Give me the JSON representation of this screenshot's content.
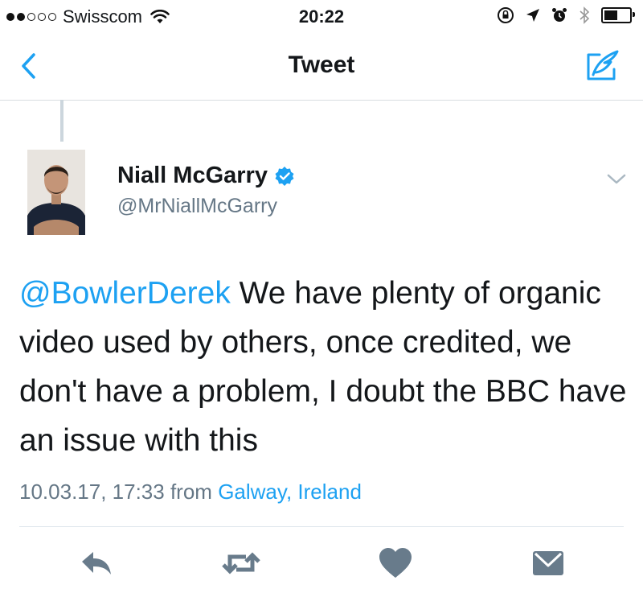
{
  "status_bar": {
    "carrier": "Swisscom",
    "time": "20:22",
    "signal_bars_filled": 2,
    "signal_bars_total": 5,
    "icons": [
      "wifi-icon",
      "orientation-lock-icon",
      "location-arrow-icon",
      "alarm-icon",
      "bluetooth-icon",
      "battery-icon"
    ]
  },
  "nav": {
    "title": "Tweet",
    "back_icon": "chevron-left-icon",
    "compose_icon": "compose-icon"
  },
  "tweet": {
    "display_name": "Niall McGarry",
    "verified": true,
    "handle": "@MrNiallMcGarry",
    "mention": "@BowlerDerek",
    "body": " We have plenty of organic video used by others, once credited, we don't have a problem, I doubt the BBC have an issue with this",
    "timestamp": "10.03.17, 17:33 from",
    "location": "Galway, Ireland"
  },
  "actions": [
    "reply-icon",
    "retweet-icon",
    "like-icon",
    "direct-message-icon"
  ],
  "colors": {
    "accent": "#1da1f2",
    "secondary_text": "#657786",
    "action_icon": "#687b8b"
  }
}
